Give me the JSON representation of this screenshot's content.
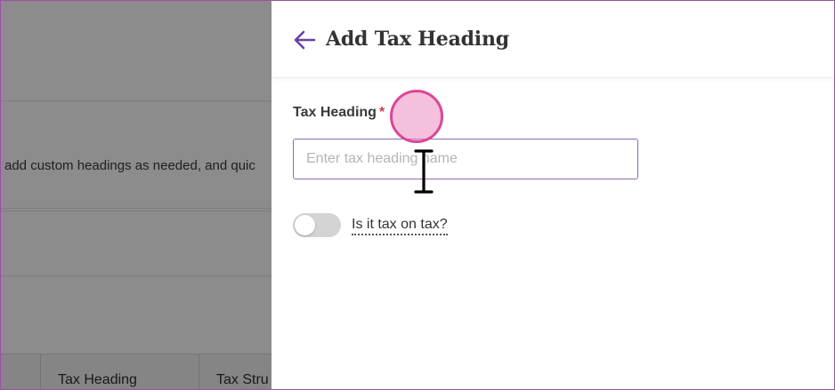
{
  "background": {
    "description_fragment": "add custom headings as needed, and quic",
    "table_columns": [
      "Tax Heading",
      "Tax Stru"
    ]
  },
  "drawer": {
    "back_icon": "arrow-left-icon",
    "title": "Add Tax Heading",
    "field_label": "Tax Heading",
    "required_marker": "*",
    "input": {
      "value": "",
      "placeholder": "Enter tax heading name"
    },
    "toggle": {
      "label": "Is it tax on tax?",
      "checked": false
    }
  },
  "colors": {
    "accent": "#6a3fa0",
    "required": "#d33a4a",
    "click_indicator": "#d9479a"
  }
}
